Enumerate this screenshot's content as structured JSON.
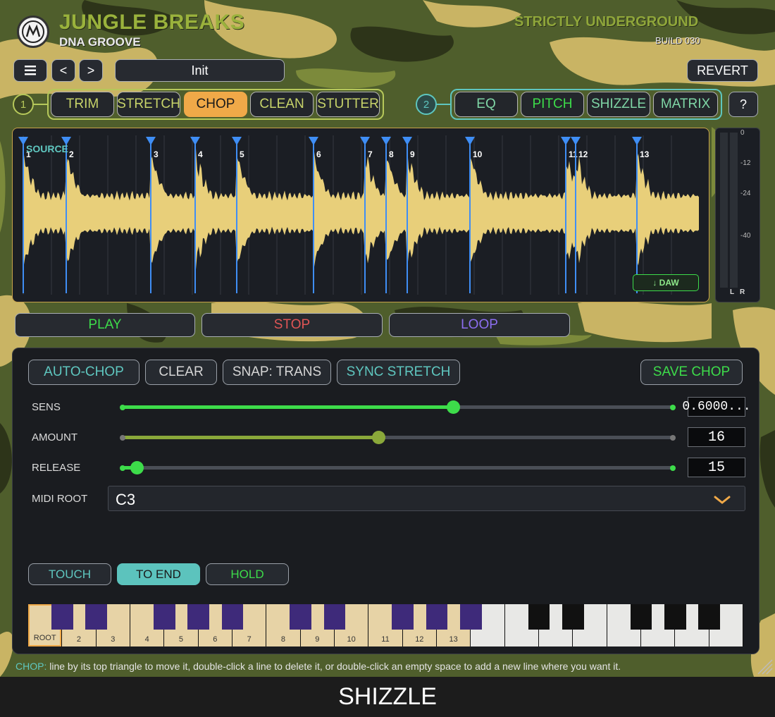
{
  "header": {
    "title": "JUNGLE BREAKS",
    "subtitle": "DNA GROOVE",
    "brand": "STRICTLY UNDERGROUND",
    "build": "BUILD 030"
  },
  "toolbar": {
    "menu_icon": "hamburger-icon",
    "prev_label": "<",
    "next_label": ">",
    "preset_name": "Init",
    "revert_label": "REVERT",
    "help_label": "?"
  },
  "tabs_group1": {
    "number": "1",
    "items": [
      "TRIM",
      "STRETCH",
      "CHOP",
      "CLEAN",
      "STUTTER"
    ],
    "active": "CHOP"
  },
  "tabs_group2": {
    "number": "2",
    "items": [
      "EQ",
      "PITCH",
      "SHIZZLE",
      "MATRIX"
    ]
  },
  "waveform": {
    "source_label": "SOURCE",
    "markers": [
      "1",
      "2",
      "3",
      "4",
      "5",
      "6",
      "7",
      "8",
      "9",
      "10",
      "11",
      "12",
      "13"
    ],
    "daw_button": "↓ DAW"
  },
  "meter": {
    "ticks": [
      "0",
      "-12",
      "-24",
      "-40"
    ],
    "channels": [
      "L",
      "R"
    ]
  },
  "transport": {
    "play": "PLAY",
    "stop": "STOP",
    "loop": "LOOP"
  },
  "chop_panel": {
    "auto_chop": "AUTO-CHOP",
    "clear": "CLEAR",
    "snap": "SNAP: TRANS",
    "sync_stretch": "SYNC STRETCH",
    "save_chop": "SAVE CHOP",
    "sens": {
      "label": "SENS",
      "value": "0.6000...",
      "level": 0.6
    },
    "amount": {
      "label": "AMOUNT",
      "value": "16",
      "level": 0.465
    },
    "release": {
      "label": "RELEASE",
      "value": "15",
      "level": 0.027
    },
    "midi_root": {
      "label": "MIDI ROOT",
      "value": "C3"
    },
    "modes": [
      "TOUCH",
      "TO END",
      "HOLD"
    ],
    "active_mode": "TO END"
  },
  "keyboard": {
    "labels": [
      "ROOT",
      "2",
      "3",
      "4",
      "5",
      "6",
      "7",
      "8",
      "9",
      "10",
      "11",
      "12",
      "13"
    ]
  },
  "footer": {
    "hint_prefix": "CHOP:",
    "hint_text": "line by its top triangle to move it, double-click a line to delete it, or double-click an empty space to add a new line where you want it.",
    "bottom_title": "SHIZZLE"
  },
  "colors": {
    "olive": "#c8d46a",
    "orange_active": "#f0a948",
    "teal": "#5fc7c0",
    "green": "#3ddc4a",
    "red": "#e05555",
    "purple": "#8c6ef0",
    "marker_blue": "#3f8ef5",
    "wave": "#e8cf7a",
    "black_key_mapped": "#3e2a7a"
  }
}
